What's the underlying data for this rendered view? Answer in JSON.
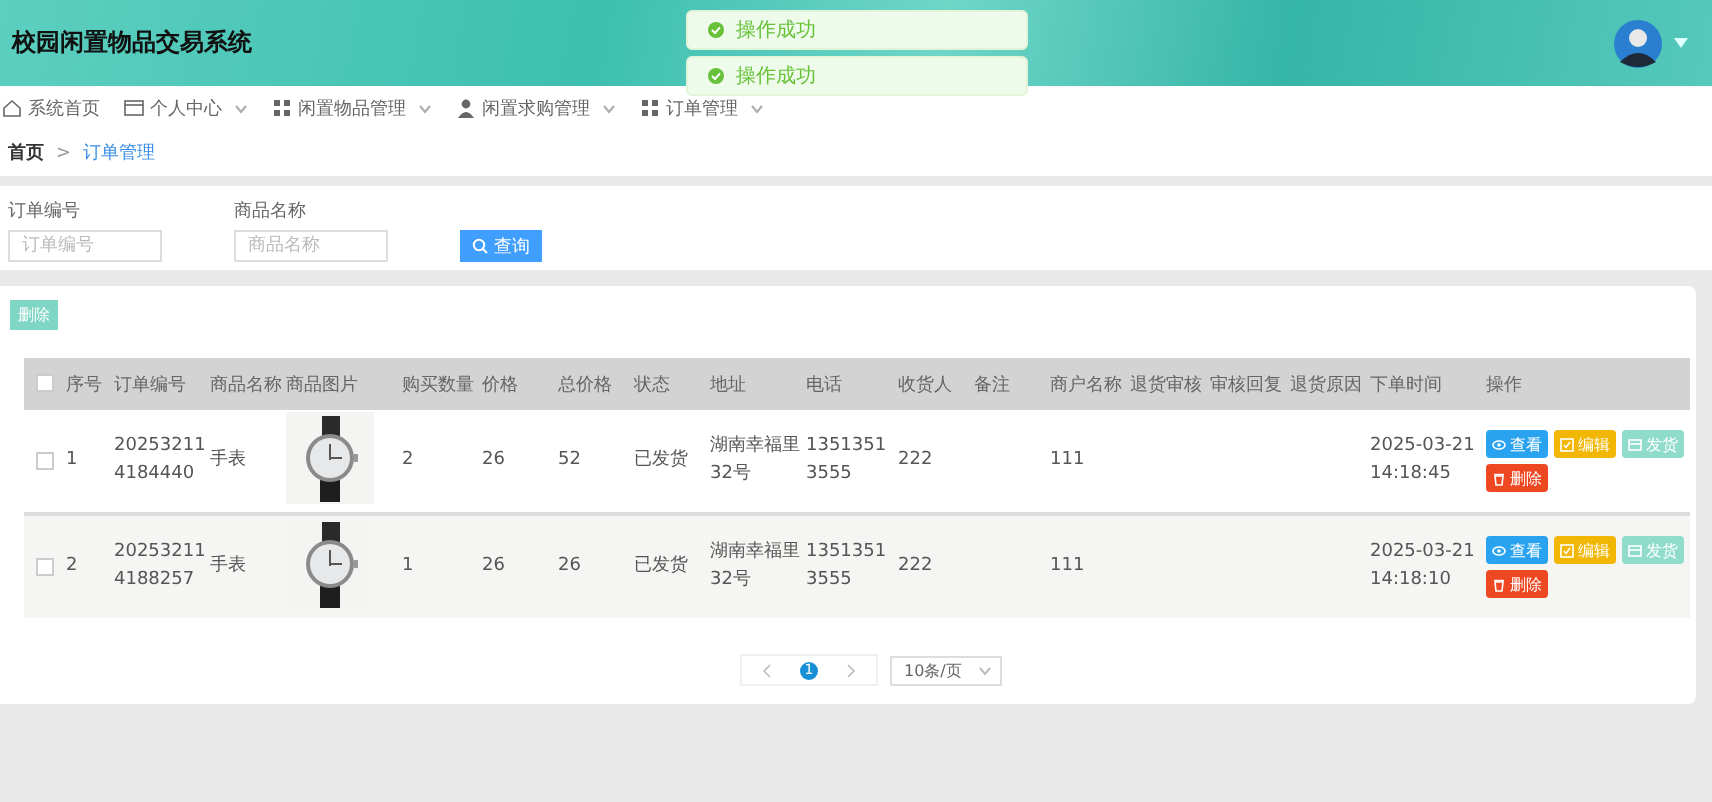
{
  "header": {
    "title": "校园闲置物品交易系统",
    "account_dropdown": true
  },
  "toasts": [
    {
      "message": "操作成功"
    },
    {
      "message": "操作成功"
    }
  ],
  "nav": [
    {
      "label": "系统首页",
      "kind": "home",
      "dropdown": false
    },
    {
      "label": "个人中心",
      "kind": "card",
      "dropdown": true
    },
    {
      "label": "闲置物品管理",
      "kind": "grid",
      "dropdown": true
    },
    {
      "label": "闲置求购管理",
      "kind": "person",
      "dropdown": true
    },
    {
      "label": "订单管理",
      "kind": "grid",
      "dropdown": true
    }
  ],
  "breadcrumb": {
    "separator": ">",
    "items": [
      {
        "label": "首页",
        "current": false
      },
      {
        "label": "订单管理",
        "current": true
      }
    ]
  },
  "search": {
    "fields": [
      {
        "label": "订单编号",
        "placeholder": "订单编号"
      },
      {
        "label": "商品名称",
        "placeholder": "商品名称"
      }
    ],
    "button": "查询"
  },
  "toolbar": {
    "delete_button": "删除"
  },
  "table": {
    "select_all": false,
    "columns": [
      {
        "label": "序号",
        "kind": "text"
      },
      {
        "label": "订单编号",
        "kind": "text"
      },
      {
        "label": "商品名称",
        "kind": "text"
      },
      {
        "label": "商品图片",
        "kind": "picture"
      },
      {
        "label": "购买数量",
        "kind": "text"
      },
      {
        "label": "价格",
        "kind": "text"
      },
      {
        "label": "总价格",
        "kind": "text"
      },
      {
        "label": "状态",
        "kind": "text"
      },
      {
        "label": "地址",
        "kind": "text"
      },
      {
        "label": "电话",
        "kind": "text"
      },
      {
        "label": "收货人",
        "kind": "text"
      },
      {
        "label": "备注",
        "kind": "text"
      },
      {
        "label": "商户名称",
        "kind": "text"
      },
      {
        "label": "退货审核",
        "kind": "text"
      },
      {
        "label": "审核回复",
        "kind": "text"
      },
      {
        "label": "退货原因",
        "kind": "text"
      },
      {
        "label": "下单时间",
        "kind": "text"
      },
      {
        "label": "操作",
        "kind": "actions"
      }
    ],
    "rows": [
      {
        "selected": false,
        "cells": [
          "1",
          "202532114184440",
          "手表",
          null,
          "2",
          "26",
          "52",
          "已发货",
          "湖南幸福里32号",
          "13513513555",
          "222",
          null,
          "111",
          null,
          null,
          null,
          "2025-03-21 14:18:45",
          null
        ],
        "actions": [
          {
            "label": "查看",
            "kind": "view"
          },
          {
            "label": "编辑",
            "kind": "edit"
          },
          {
            "label": "发货",
            "kind": "ship"
          },
          {
            "label": "删除",
            "kind": "delete"
          }
        ]
      },
      {
        "selected": false,
        "cells": [
          "2",
          "202532114188257",
          "手表",
          null,
          "1",
          "26",
          "26",
          "已发货",
          "湖南幸福里32号",
          "13513513555",
          "222",
          null,
          "111",
          null,
          null,
          null,
          "2025-03-21 14:18:10",
          null
        ],
        "actions": [
          {
            "label": "查看",
            "kind": "view"
          },
          {
            "label": "编辑",
            "kind": "edit"
          },
          {
            "label": "发货",
            "kind": "ship"
          },
          {
            "label": "删除",
            "kind": "delete"
          }
        ]
      }
    ]
  },
  "pagination": {
    "pages": [
      {
        "label": "1",
        "selected": true
      }
    ],
    "page_size": "10条/页"
  }
}
